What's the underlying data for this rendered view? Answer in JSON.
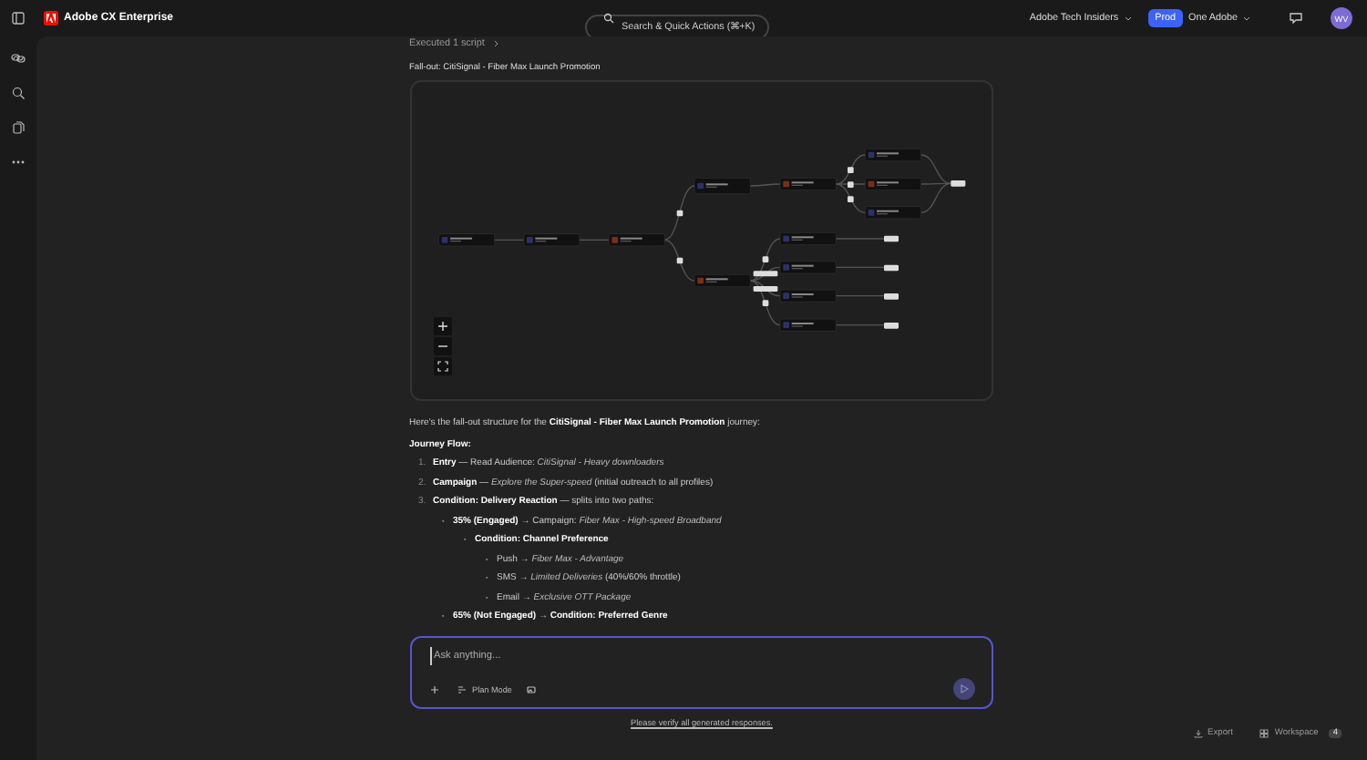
{
  "app": {
    "title": "Adobe CX Enterprise"
  },
  "search": {
    "placeholder": "Search & Quick Actions (⌘+K)"
  },
  "header": {
    "org": "Adobe Tech Insiders",
    "environment": "Prod",
    "profile": "One Adobe",
    "avatar": "WV"
  },
  "chat": {
    "script_status": "Executed 1 script",
    "diagram_title": "Fall-out: CitiSignal - Fiber Max Launch Promotion",
    "intro": "Here's the fall-out structure for the **CitiSignal - Fiber Max Launch Promotion** journey:",
    "heading": "Journey Flow:",
    "steps": [
      {
        "marker": "1.",
        "text": "**Entry** — Read Audience: *CitiSignal - Heavy downloaders*"
      },
      {
        "marker": "2.",
        "text": "**Campaign** — *Explore the Super-speed* (initial outreach to all profiles)"
      },
      {
        "marker": "3.",
        "text": "**Condition: Delivery Reaction** — splits into two paths:",
        "children": [
          {
            "marker": "▪",
            "text": "**35% (Engaged)** → Campaign: *Fiber Max - High-speed Broadband*",
            "children": [
              {
                "marker": "▪",
                "text": "**Condition: Channel Preference**",
                "children": [
                  {
                    "marker": "▪",
                    "text": "Push → *Fiber Max - Advantage*"
                  },
                  {
                    "marker": "▪",
                    "text": "SMS → *Limited Deliveries* (40%/60% throttle)"
                  },
                  {
                    "marker": "▪",
                    "text": "Email → *Exclusive OTT Package*"
                  }
                ]
              }
            ]
          },
          {
            "marker": "▪",
            "text": "**65% (Not Engaged)** → **Condition: Preferred Genre**"
          }
        ]
      }
    ]
  },
  "composer": {
    "placeholder": "Ask anything...",
    "mode": "Plan Mode"
  },
  "disclaimer": "Please verify all generated responses.",
  "footer": {
    "export": "Export",
    "workspace": "Workspace",
    "workspace_count": "4"
  }
}
